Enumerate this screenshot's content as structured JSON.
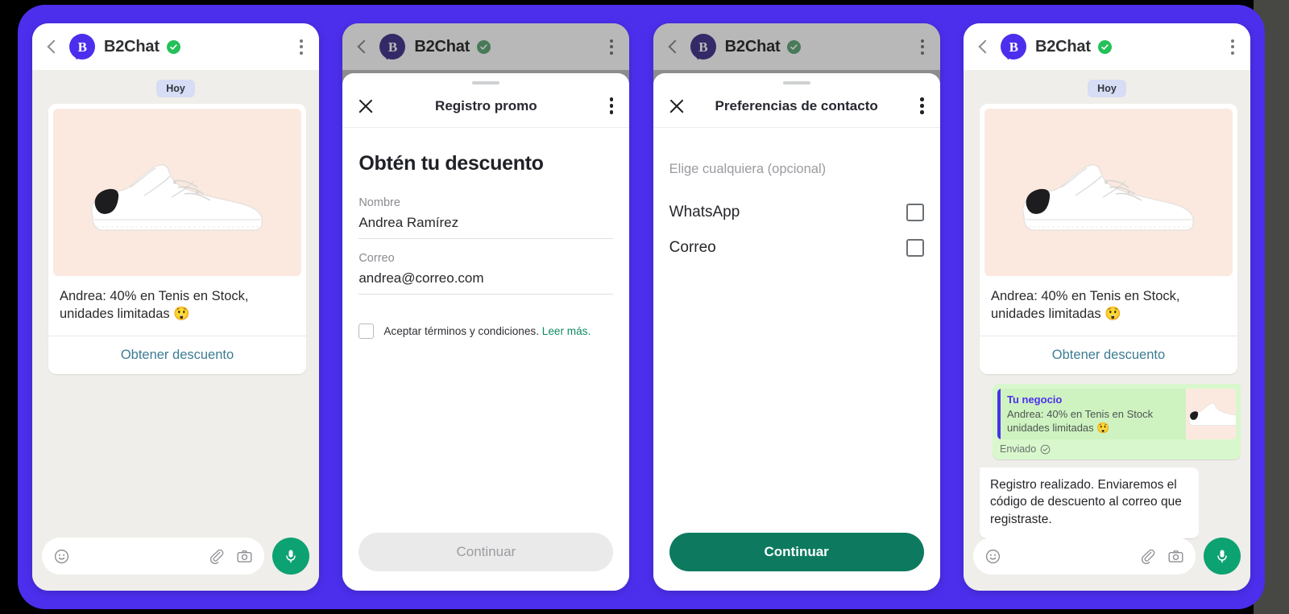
{
  "theme": {
    "backdrop": "#000000",
    "frame_purple": "#4b2fed",
    "right_gutter": "#474743",
    "chat_bg": "#efeeea",
    "brand_purple": "#4b2fed",
    "verified_green": "#24c05a",
    "mic_green": "#0da271",
    "primary_green": "#0d7a5f",
    "link_teal": "#3d7c94",
    "terms_link_green": "#0f8a62",
    "sent_bubble_green": "#d9f7cd",
    "quote_green": "#cef2c0",
    "product_image_bg": "#fbe9e0",
    "day_chip_bg": "#d7ddf5"
  },
  "chat_header": {
    "back_icon": "chevron-left-icon",
    "avatar_mark": "B",
    "title": "B2Chat",
    "verified_icon": "verified-check-icon",
    "menu_icon": "kebab-menu-icon"
  },
  "panel1": {
    "day_chip": "Hoy",
    "card": {
      "image_alt": "white-sneaker-photo",
      "text": "Andrea: 40% en Tenis en Stock, unidades limitadas 😲",
      "action_label": "Obtener descuento"
    },
    "composer": {
      "emoji_icon": "emoji-smiley-icon",
      "attach_icon": "paperclip-icon",
      "camera_icon": "camera-icon",
      "mic_icon": "microphone-icon",
      "placeholder": ""
    }
  },
  "panel2": {
    "sheet": {
      "close_icon": "close-x-icon",
      "title": "Registro promo",
      "menu_icon": "kebab-menu-icon",
      "heading": "Obtén tu descuento",
      "fields": [
        {
          "label": "Nombre",
          "value": "Andrea Ramírez"
        },
        {
          "label": "Correo",
          "value": "andrea@correo.com"
        }
      ],
      "terms": {
        "checkbox_icon": "checkbox-unchecked-icon",
        "text": "Aceptar términos y condiciones.",
        "link": "Leer más."
      },
      "submit_label": "Continuar",
      "submit_state": "disabled"
    }
  },
  "panel3": {
    "sheet": {
      "close_icon": "close-x-icon",
      "title": "Preferencias de contacto",
      "menu_icon": "kebab-menu-icon",
      "hint": "Elige cualquiera (opcional)",
      "options": [
        {
          "label": "WhatsApp",
          "checkbox_icon": "checkbox-unchecked-icon"
        },
        {
          "label": "Correo",
          "checkbox_icon": "checkbox-unchecked-icon"
        }
      ],
      "submit_label": "Continuar",
      "submit_state": "enabled"
    }
  },
  "panel4": {
    "day_chip": "Hoy",
    "card": {
      "image_alt": "white-sneaker-photo",
      "text": "Andrea: 40% en Tenis en Stock, unidades limitadas 😲",
      "action_label": "Obtener descuento"
    },
    "sent_message": {
      "quote_name": "Tu negocio",
      "quote_text": "Andrea: 40% en Tenis en Stock unidades limitadas 😲",
      "thumb_alt": "white-sneaker-thumbnail",
      "status": "Enviado",
      "status_icon": "check-circle-icon"
    },
    "received_message": {
      "text": "Registro realizado. Enviaremos el código de descuento al correo que registraste."
    },
    "composer": {
      "emoji_icon": "emoji-smiley-icon",
      "attach_icon": "paperclip-icon",
      "camera_icon": "camera-icon",
      "mic_icon": "microphone-icon",
      "placeholder": ""
    }
  }
}
